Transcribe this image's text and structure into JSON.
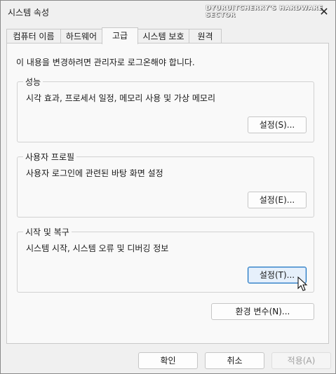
{
  "window": {
    "title": "시스템 속성",
    "watermark": "DYURUITCHERRY'S HARDWARE SECTOR"
  },
  "tabs": [
    {
      "label": "컴퓨터 이름"
    },
    {
      "label": "하드웨어"
    },
    {
      "label": "고급",
      "active": true
    },
    {
      "label": "시스템 보호"
    },
    {
      "label": "원격"
    }
  ],
  "notice": "이 내용을 변경하려면 관리자로 로그온해야 합니다.",
  "performance": {
    "title": "성능",
    "desc": "시각 효과, 프로세서 일정, 메모리 사용 및 가상 메모리",
    "button": "설정(S)..."
  },
  "profile": {
    "title": "사용자 프로필",
    "desc": "사용자 로그인에 관련된 바탕 화면 설정",
    "button": "설정(E)..."
  },
  "startup": {
    "title": "시작 및 복구",
    "desc": "시스템 시작, 시스템 오류 및 디버깅 정보",
    "button": "설정(T)..."
  },
  "env_button": "환경 변수(N)...",
  "footer": {
    "ok": "확인",
    "cancel": "취소",
    "apply": "적용(A)"
  },
  "icons": {
    "close": "close-icon",
    "cursor": "mouse-pointer-icon"
  }
}
